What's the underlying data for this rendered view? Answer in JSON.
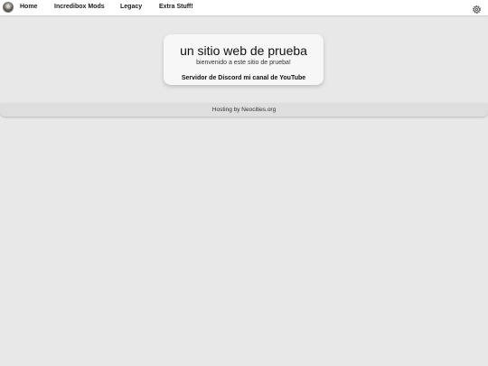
{
  "nav": {
    "items": [
      {
        "label": "Home"
      },
      {
        "label": "Incredibox Mods"
      },
      {
        "label": "Legacy"
      },
      {
        "label": "Extra Stuff!"
      }
    ],
    "icons": {
      "avatar": "avatar-image",
      "settings": "gear-icon"
    }
  },
  "card": {
    "title": "un sitio web de prueba",
    "subtitle": "bienvenido a este sitio de prueba!",
    "links": [
      {
        "label": "Servidor de Discord"
      },
      {
        "label": "mi canal de YouTube"
      }
    ]
  },
  "footer": {
    "text": "Hosting by Neocities.org"
  },
  "colors": {
    "background": "#e8e8e8",
    "navbar": "#ffffff",
    "card": "#f7f7f7",
    "footer": "#dedede"
  }
}
